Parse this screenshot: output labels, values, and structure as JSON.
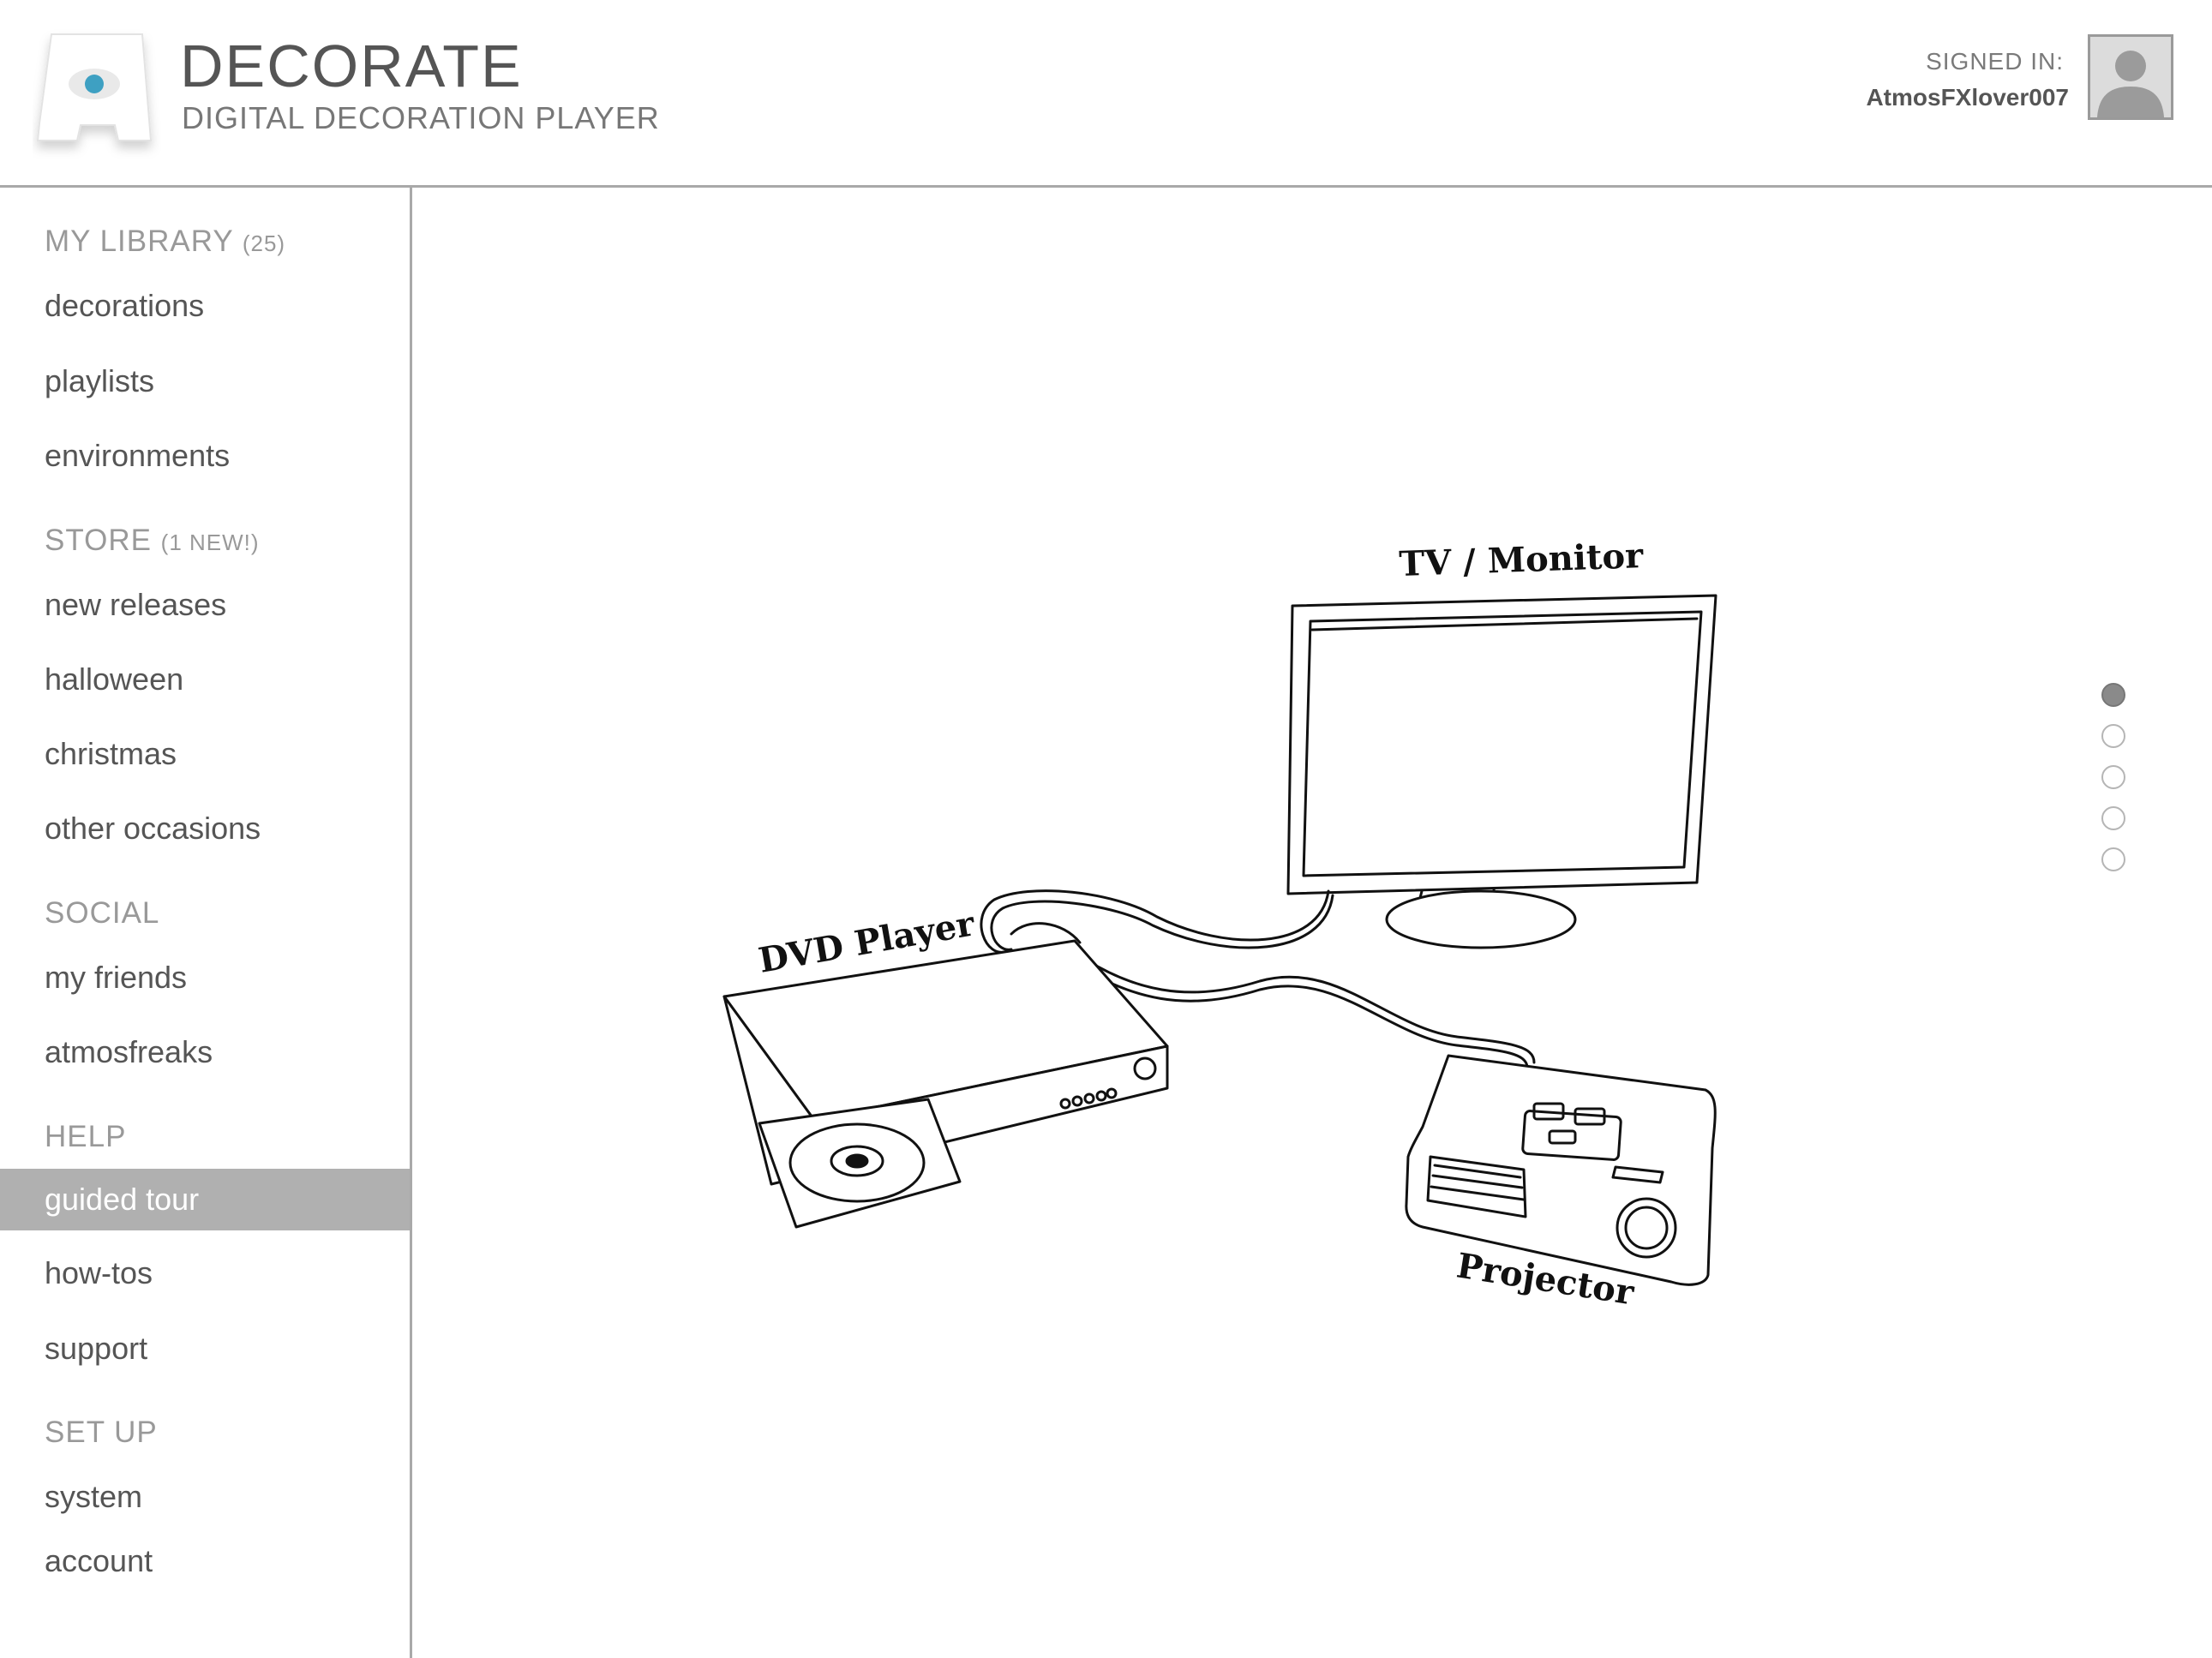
{
  "header": {
    "title": "DECORATE",
    "subtitle": "DIGITAL DECORATION PLAYER",
    "signed_in_label": "SIGNED IN:",
    "username": "AtmosFXlover007"
  },
  "sidebar": {
    "sections": [
      {
        "heading": "MY LIBRARY",
        "count": "(25)",
        "items": [
          "decorations",
          "playlists",
          "environments"
        ]
      },
      {
        "heading": "STORE",
        "count": "(1 NEW!)",
        "items": [
          "new releases",
          "halloween",
          "christmas",
          "other occasions"
        ]
      },
      {
        "heading": "SOCIAL",
        "count": "",
        "items": [
          "my friends",
          "atmosfreaks"
        ]
      },
      {
        "heading": "HELP",
        "count": "",
        "items": [
          "guided tour",
          "how-tos",
          "support"
        ]
      },
      {
        "heading": "SET UP",
        "count": "",
        "items": [
          "system",
          "account"
        ]
      }
    ],
    "active_item": "guided tour"
  },
  "illustration": {
    "labels": {
      "tv": "TV / Monitor",
      "dvd": "DVD Player",
      "projector": "Projector"
    }
  },
  "pager": {
    "total": 5,
    "current": 1
  },
  "colors": {
    "accent_eye": "#3ea0c2",
    "active_item_bg": "#b0b0b0",
    "divider": "#a9a9a9"
  }
}
